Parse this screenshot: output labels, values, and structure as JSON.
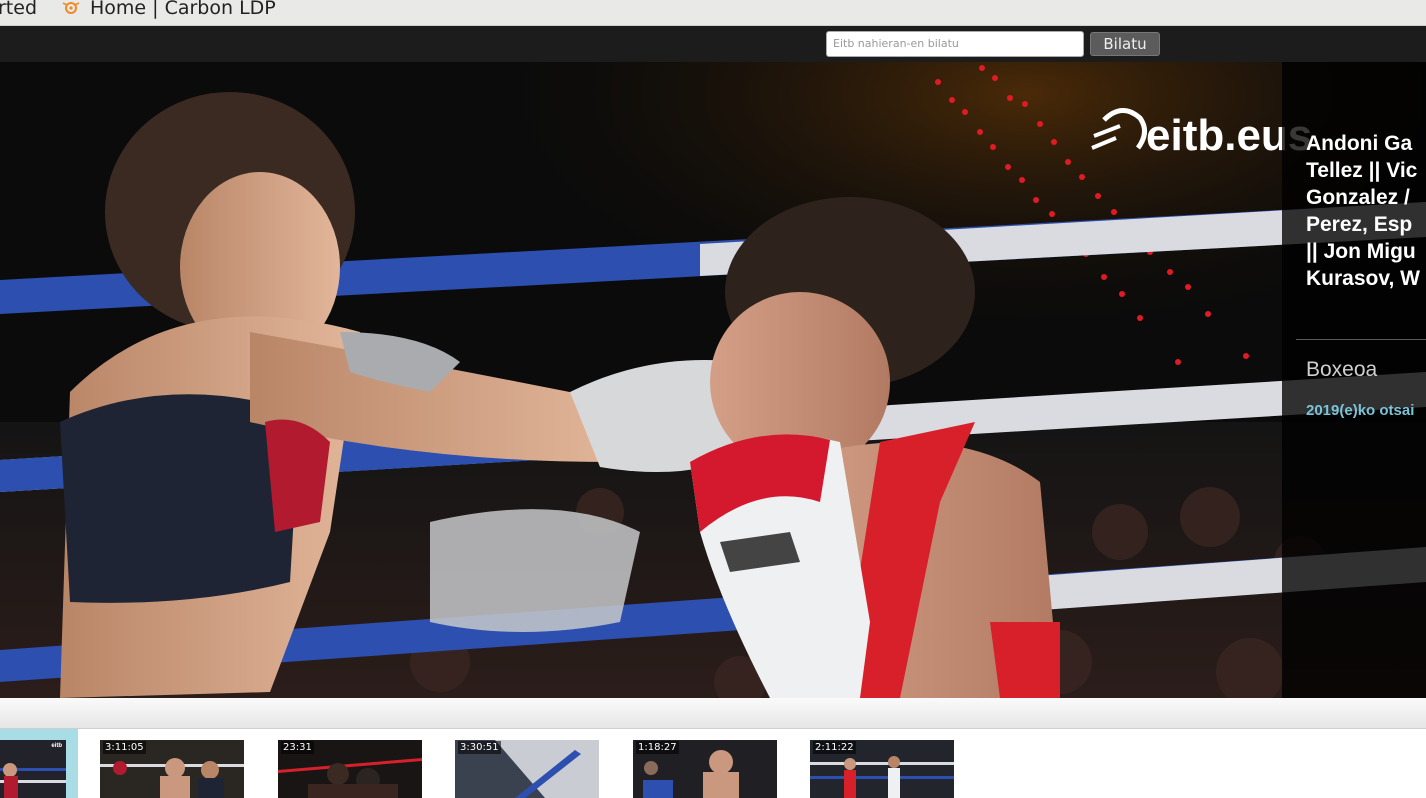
{
  "bookmarks": {
    "items": [
      {
        "label": "rted"
      },
      {
        "label": "Home | Carbon LDP",
        "icon": "carbon-ldp-icon"
      }
    ]
  },
  "header": {
    "search": {
      "placeholder": "Eitb nahieran-en bilatu",
      "value": ""
    },
    "search_button": "Bilatu"
  },
  "player": {
    "logo_text": "eitb.eus",
    "title": "Andoni Ga\nTellez || Vic\nGonzalez /\nPerez, Esp\n|| Jon Migu\nKurasov, W",
    "category": "Boxeoa",
    "date": "2019(e)ko otsai"
  },
  "carousel": {
    "thumbnails": [
      {
        "duration": ""
      },
      {
        "duration": "3:11:05"
      },
      {
        "duration": "23:31"
      },
      {
        "duration": "3:30:51"
      },
      {
        "duration": "1:18:27"
      },
      {
        "duration": "2:11:22"
      }
    ]
  },
  "colors": {
    "header_bg": "#1c1c1c",
    "date_accent": "#7cc3d6",
    "active_thumb": "#a9dde6",
    "ring_rope_blue": "#2c4fb0",
    "corner_red": "#d8202a"
  }
}
